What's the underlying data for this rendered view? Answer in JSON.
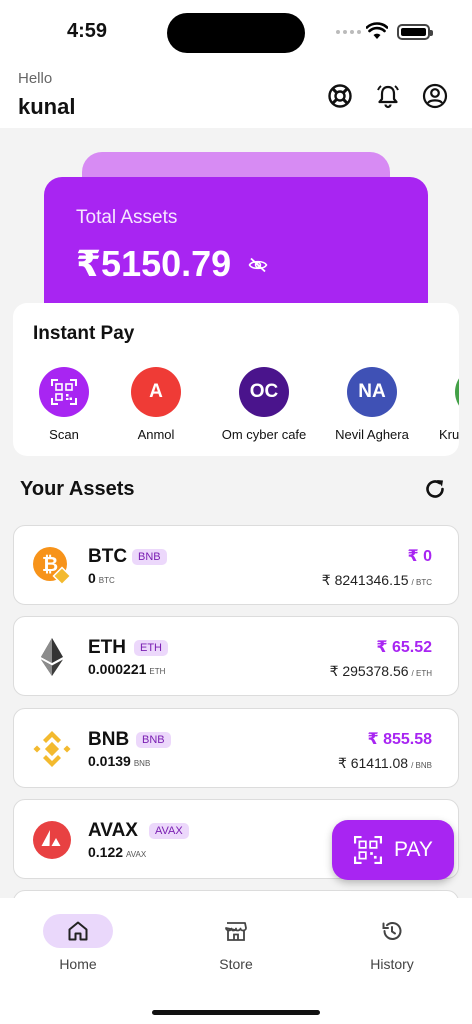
{
  "status": {
    "time": "4:59"
  },
  "header": {
    "greeting": "Hello",
    "username": "kunal"
  },
  "card": {
    "label": "Total Assets",
    "value": "₹5150.79"
  },
  "instant_pay": {
    "title": "Instant Pay",
    "items": [
      {
        "label": "Scan",
        "initials": "",
        "color": "#a825f2"
      },
      {
        "label": "Anmol",
        "initials": "A",
        "color": "#ef3b36"
      },
      {
        "label": "Om cyber cafe",
        "initials": "OC",
        "color": "#4a148c"
      },
      {
        "label": "Nevil Aghera",
        "initials": "NA",
        "color": "#3f51b5"
      },
      {
        "label": "Kru",
        "initials": "",
        "color": "#43a047"
      }
    ]
  },
  "assets": {
    "title": "Your Assets",
    "items": [
      {
        "symbol": "BTC",
        "tag": "BNB",
        "qty": "0",
        "qty_unit": "BTC",
        "inr": "₹ 0",
        "rate": "₹ 8241346.15",
        "rate_unit": "/ BTC"
      },
      {
        "symbol": "ETH",
        "tag": "ETH",
        "qty": "0.000221",
        "qty_unit": "ETH",
        "inr": "₹ 65.52",
        "rate": "₹ 295378.56",
        "rate_unit": "/ ETH"
      },
      {
        "symbol": "BNB",
        "tag": "BNB",
        "qty": "0.0139",
        "qty_unit": "BNB",
        "inr": "₹ 855.58",
        "rate": "₹ 61411.08",
        "rate_unit": "/ BNB"
      },
      {
        "symbol": "AVAX",
        "tag": "AVAX",
        "qty": "0.122",
        "qty_unit": "AVAX",
        "inr": "",
        "rate": "",
        "rate_unit": ""
      }
    ]
  },
  "fab": {
    "label": "PAY"
  },
  "nav": {
    "items": [
      {
        "label": "Home"
      },
      {
        "label": "Store"
      },
      {
        "label": "History"
      }
    ]
  },
  "colors": {
    "accent": "#a825f2",
    "accent_light": "#ead8fb"
  }
}
